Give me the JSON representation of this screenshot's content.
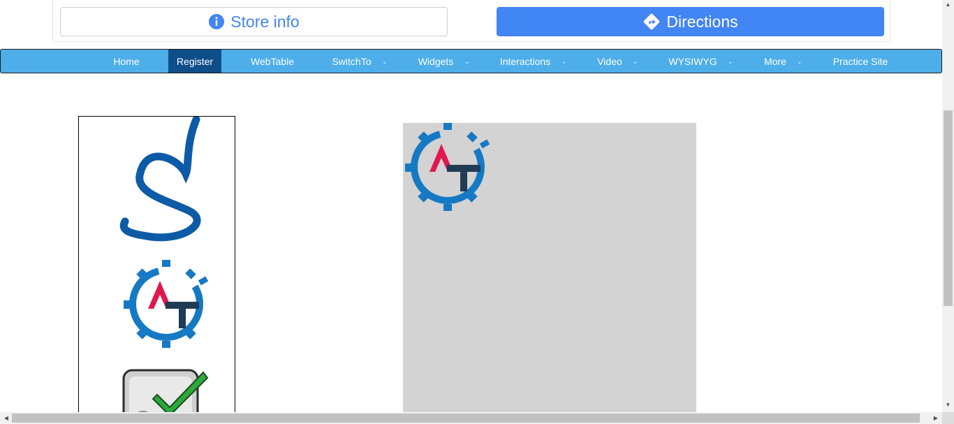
{
  "ad": {
    "store_label": "Store info",
    "directions_label": "Directions"
  },
  "nav": {
    "items": [
      {
        "label": "Home",
        "has_dropdown": false,
        "active": false
      },
      {
        "label": "Register",
        "has_dropdown": false,
        "active": true
      },
      {
        "label": "WebTable",
        "has_dropdown": false,
        "active": false
      },
      {
        "label": "SwitchTo",
        "has_dropdown": true,
        "active": false
      },
      {
        "label": "Widgets",
        "has_dropdown": true,
        "active": false
      },
      {
        "label": "Interactions",
        "has_dropdown": true,
        "active": false
      },
      {
        "label": "Video",
        "has_dropdown": true,
        "active": false
      },
      {
        "label": "WYSIWYG",
        "has_dropdown": true,
        "active": false
      },
      {
        "label": "More",
        "has_dropdown": true,
        "active": false
      },
      {
        "label": "Practice Site",
        "has_dropdown": false,
        "active": false
      }
    ]
  },
  "colors": {
    "nav_bg": "#4daee9",
    "nav_active": "#0e4f8a",
    "ad_blue": "#4285f4",
    "drop_area": "#d3d3d3"
  },
  "icons": [
    "info-icon",
    "directions-icon",
    "chevron-down-icon",
    "selenium-logo",
    "automation-testing-logo",
    "checkmark-logo"
  ]
}
